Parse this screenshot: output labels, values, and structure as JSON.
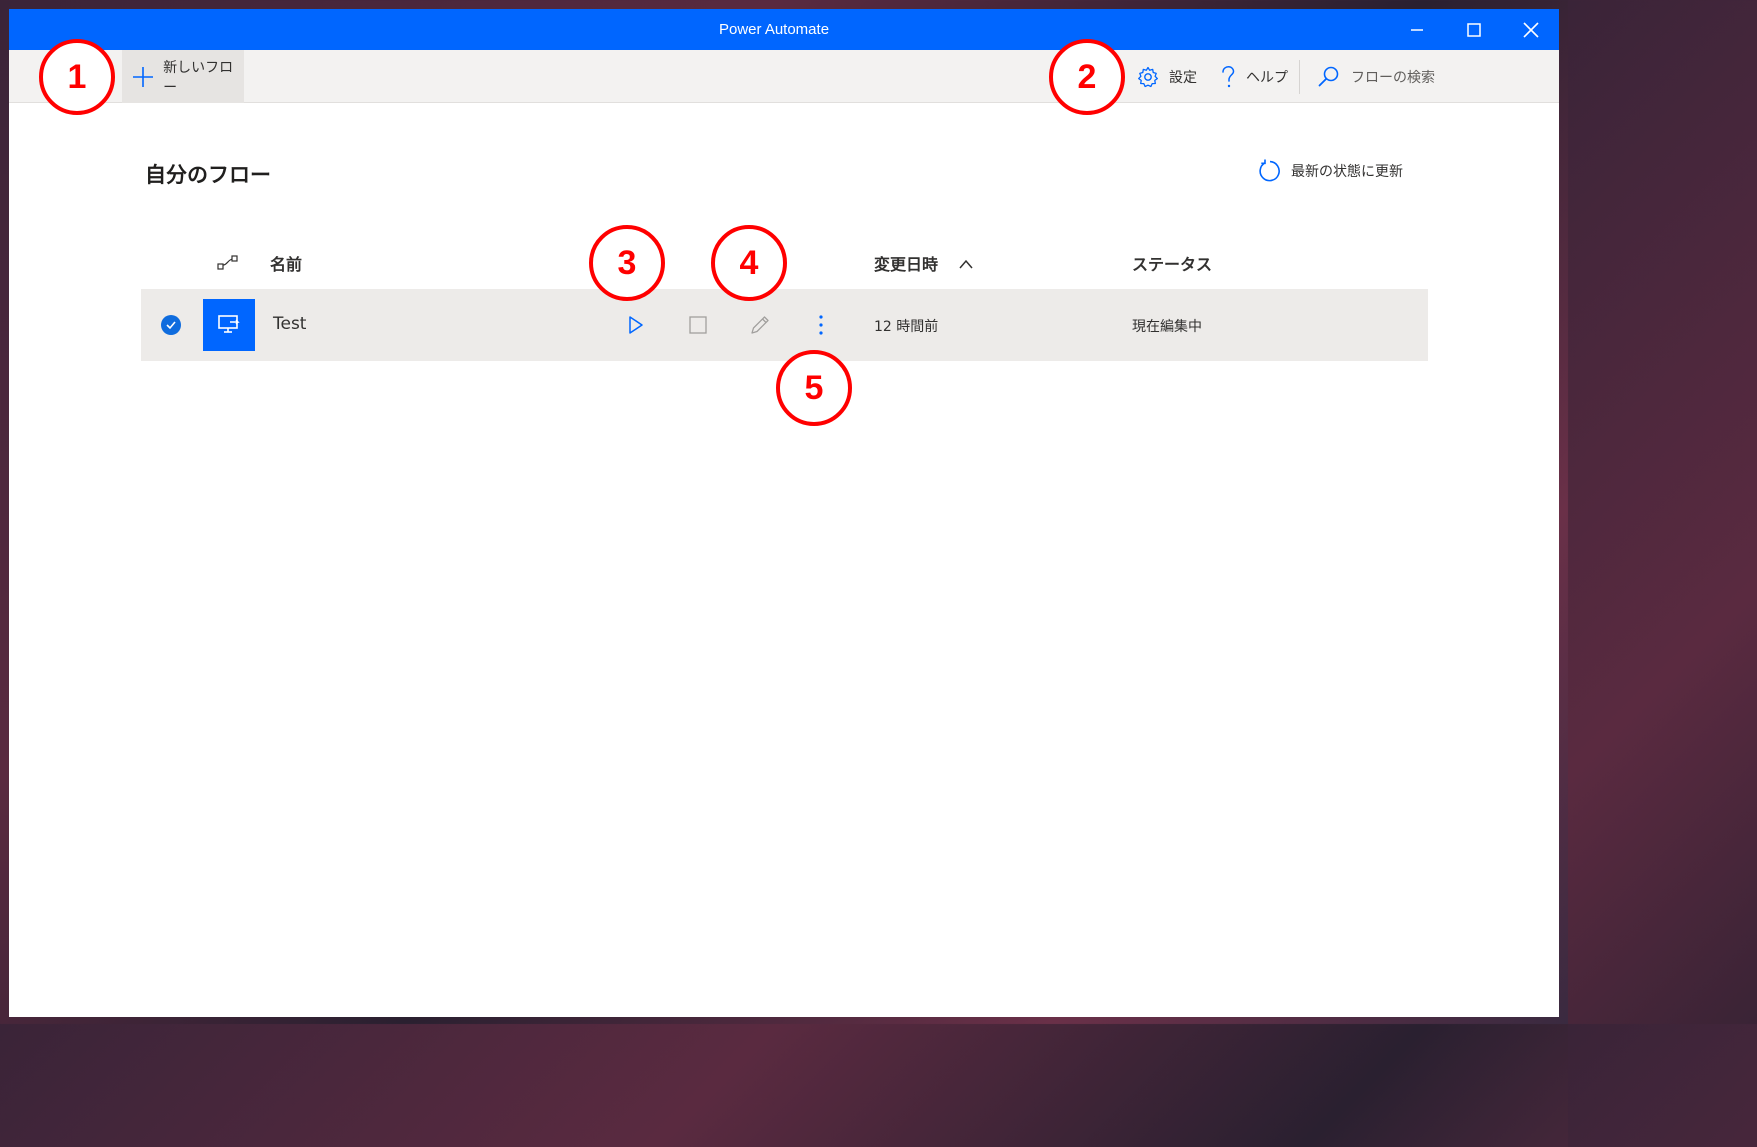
{
  "window": {
    "title": "Power Automate"
  },
  "toolbar": {
    "new_flow_label": "新しいフロー",
    "settings_label": "設定",
    "help_label": "ヘルプ",
    "search_label": "フローの検索"
  },
  "main": {
    "heading": "自分のフロー",
    "refresh_label": "最新の状態に更新",
    "columns": {
      "name": "名前",
      "modified": "変更日時",
      "status": "ステータス"
    },
    "rows": [
      {
        "name": "Test",
        "modified": "12 時間前",
        "status": "現在編集中",
        "selected": true
      }
    ]
  },
  "annotations": [
    "1",
    "2",
    "3",
    "4",
    "5"
  ],
  "colors": {
    "accent": "#0066ff",
    "annotation": "#ff0000",
    "row_bg": "#edebe9",
    "toolbar_bg": "#f3f2f1"
  },
  "icons": [
    "plus-icon",
    "gear-icon",
    "help-icon",
    "search-icon",
    "refresh-icon",
    "flow-type-icon",
    "run-icon",
    "stop-icon",
    "edit-icon",
    "more-icon",
    "sort-asc-icon",
    "desktop-flow-icon",
    "check-icon"
  ]
}
